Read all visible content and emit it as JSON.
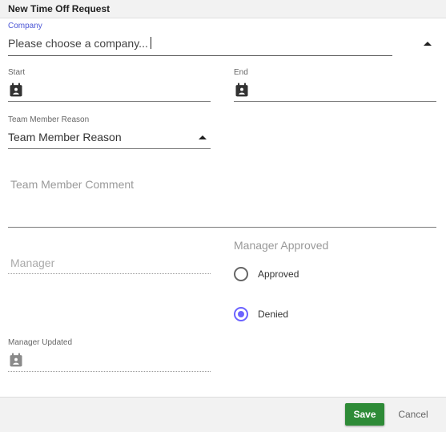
{
  "dialog": {
    "title": "New Time Off Request"
  },
  "company": {
    "label": "Company",
    "value": "Please choose a company..."
  },
  "start": {
    "label": "Start",
    "icon": "calendar-icon"
  },
  "end": {
    "label": "End",
    "icon": "calendar-icon"
  },
  "reason": {
    "label": "Team Member Reason",
    "value": "Team Member Reason"
  },
  "comment": {
    "placeholder": "Team Member Comment"
  },
  "manager": {
    "placeholder": "Manager"
  },
  "manager_approved": {
    "label": "Manager Approved",
    "options": [
      {
        "label": "Approved",
        "checked": false
      },
      {
        "label": "Denied",
        "checked": true
      }
    ]
  },
  "manager_updated": {
    "label": "Manager Updated",
    "icon": "calendar-icon"
  },
  "footer": {
    "save_label": "Save",
    "cancel_label": "Cancel"
  },
  "colors": {
    "accent": "#4a55d6",
    "radio_selected": "#6c63ff",
    "save_button": "#2e8b37"
  }
}
